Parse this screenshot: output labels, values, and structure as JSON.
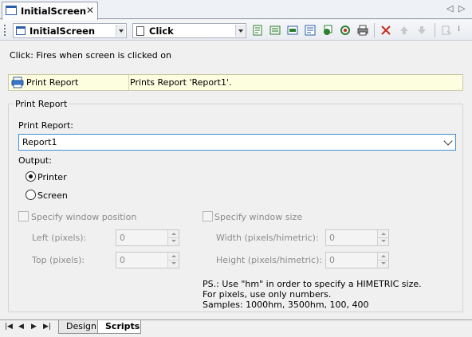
{
  "tab": {
    "title": "InitialScreen",
    "close": "✕",
    "nav_prev": "◁",
    "nav_next": "▷"
  },
  "toolbar": {
    "screen_combo": "InitialScreen",
    "event_combo": "Click",
    "icons": [
      "new-action-icon",
      "insert-action-icon",
      "edit-action-icon",
      "properties-icon",
      "run-action-icon",
      "refresh-icon",
      "print-icon",
      "delete-icon",
      "move-up-icon",
      "move-down-icon",
      "export-icon"
    ]
  },
  "event_description": "Click: Fires when screen is clicked on",
  "action": {
    "name": "Print Report",
    "description": "Prints Report 'Report1'."
  },
  "group": {
    "title": "Print Report",
    "report_label": "Print Report:",
    "report_value": "Report1",
    "output_label": "Output:",
    "output_options": [
      {
        "label": "Printer",
        "selected": true
      },
      {
        "label": "Screen",
        "selected": false
      }
    ],
    "window_position": {
      "label": "Specify window position",
      "left_label": "Left (pixels):",
      "left_value": "0",
      "top_label": "Top (pixels):",
      "top_value": "0"
    },
    "window_size": {
      "label": "Specify window size",
      "width_label": "Width (pixels/himetric):",
      "width_value": "0",
      "height_label": "Height (pixels/himetric):",
      "height_value": "0"
    },
    "note": {
      "line1": "PS.: Use \"hm\" in order to specify a HIMETRIC size.",
      "line2": "For pixels, use only numbers.",
      "line3": "Samples: 1000hm, 3500hm, 100, 400"
    }
  },
  "bottom": {
    "nav": [
      "|◀",
      "◀",
      "▶",
      "▶|"
    ],
    "tabs": [
      {
        "label": "Design",
        "active": false
      },
      {
        "label": "Scripts",
        "active": true
      }
    ]
  },
  "colors": {
    "accent": "#3d8ed6",
    "action_row_bg": "#fdfde0",
    "delete_red": "#c42b1c"
  }
}
